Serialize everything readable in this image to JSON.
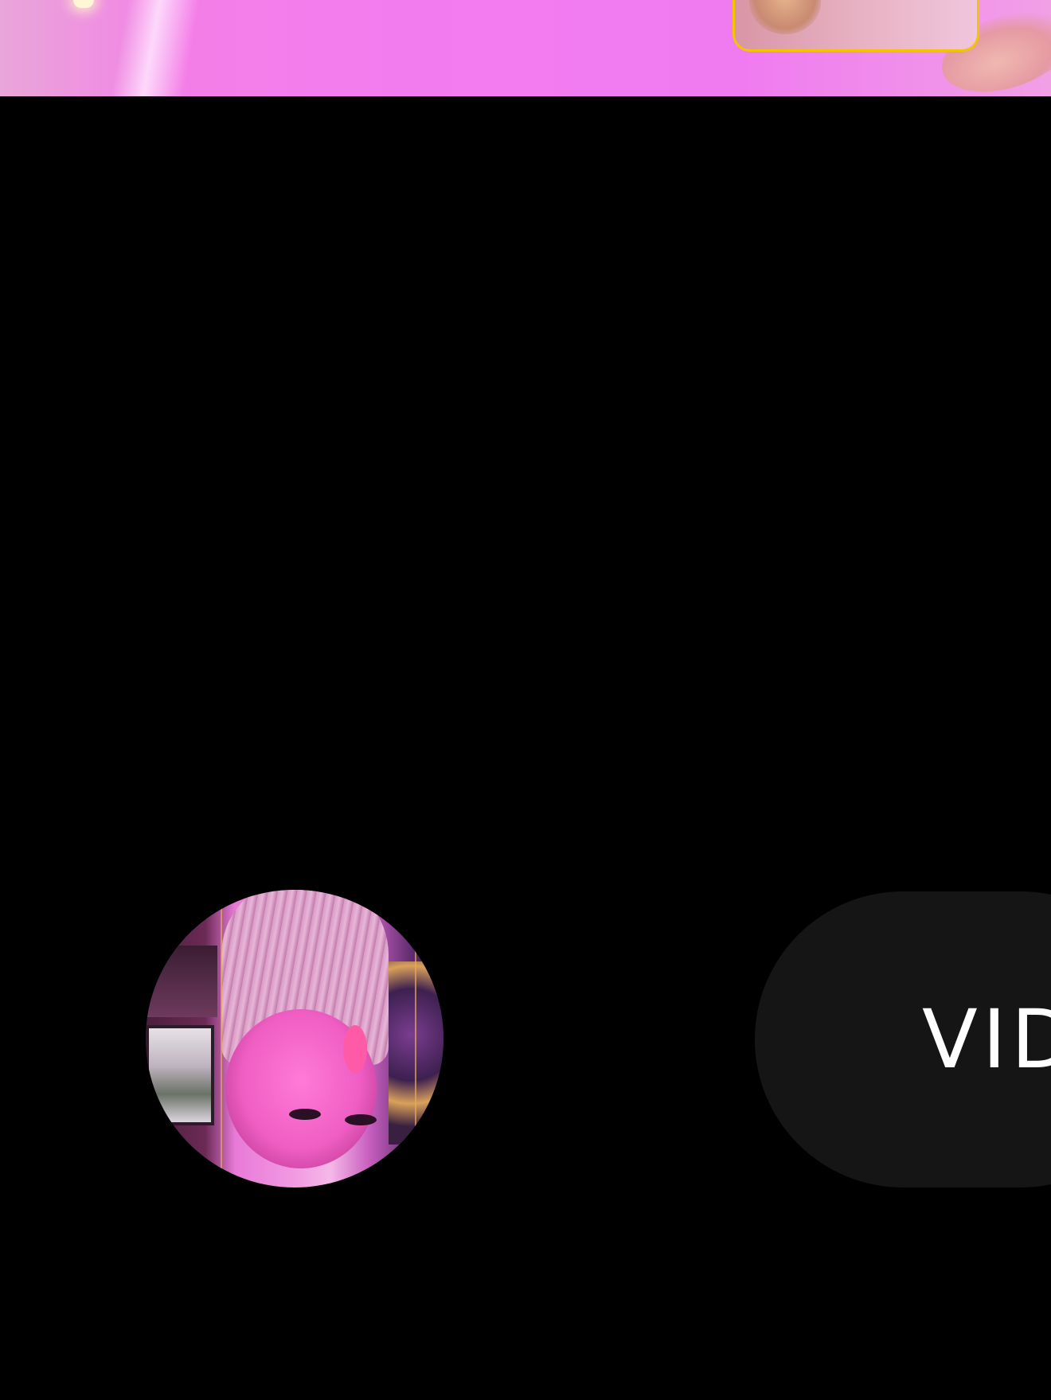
{
  "camera": {
    "preview_tint": "#f27cf0",
    "face_box_color": "#f5c400"
  },
  "thumbnail": {
    "icon": "last-capture-thumbnail"
  },
  "mode_switch": {
    "label": "VID",
    "background": "#151515",
    "text_color": "#ffffff"
  }
}
